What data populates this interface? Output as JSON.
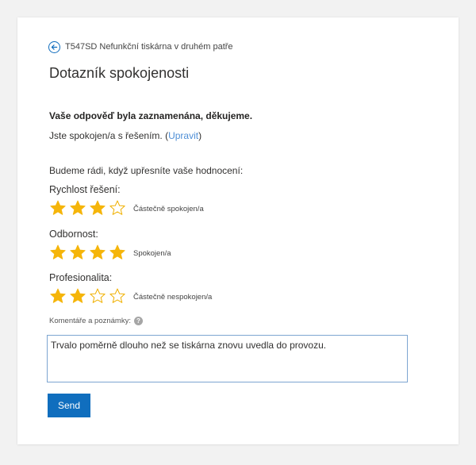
{
  "header": {
    "ticket_title": "T547SD Nefunkční tiskárna v druhém patře",
    "page_title": "Dotazník spokojenosti"
  },
  "confirmation": {
    "message": "Vaše odpověď byla zaznamenána, děkujeme.",
    "status_prefix": "Jste spokojen/a s řešením. (",
    "edit_link": "Upravit",
    "status_suffix": ")"
  },
  "ratings_intro": "Budeme rádi, když upřesníte vaše hodnocení:",
  "ratings": [
    {
      "label": "Rychlost řešení:",
      "stars": 3,
      "max": 4,
      "text": "Částečně spokojen/a"
    },
    {
      "label": "Odbornost:",
      "stars": 4,
      "max": 4,
      "text": "Spokojen/a"
    },
    {
      "label": "Profesionalita:",
      "stars": 2,
      "max": 4,
      "text": "Částečně nespokojen/a"
    }
  ],
  "comments": {
    "label": "Komentáře a poznámky:",
    "help_icon": "question-mark-icon",
    "value": "Trvalo poměrně dlouho než se tiskárna znovu uvedla do provozu."
  },
  "send_label": "Send",
  "colors": {
    "star_filled": "#f5b50a",
    "star_outline": "#f0b000",
    "accent": "#106ebe",
    "link": "#4f8fd6"
  }
}
